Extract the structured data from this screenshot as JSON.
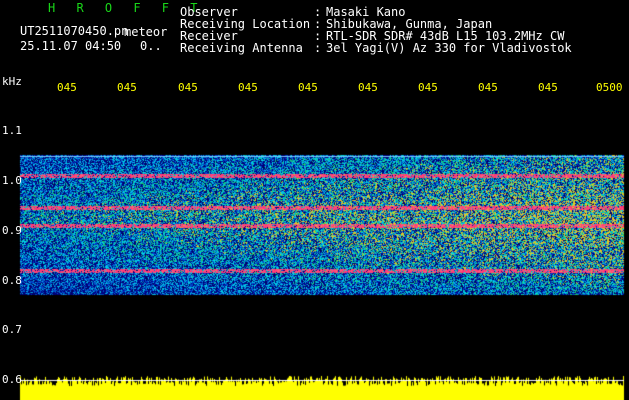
{
  "header": {
    "app_name": "H R O F F T",
    "filename": "UT2511070450.pn",
    "tag": "meteor",
    "datetime": "25.11.07 04:50",
    "count": "0..",
    "fields": [
      {
        "label": "Observer",
        "value": "Masaki Kano"
      },
      {
        "label": "Receiving Location",
        "value": "Shibukawa, Gunma, Japan"
      },
      {
        "label": "Receiver",
        "value": "RTL-SDR SDR# 43dB L15 103.2MHz CW"
      },
      {
        "label": "Receiving Antenna",
        "value": "3el Yagi(V) Az 330 for Vladivostok"
      }
    ]
  },
  "axis": {
    "y_unit": "kHz",
    "y_ticks": [
      "1.1",
      "1.0",
      "0.9",
      "0.8",
      "0.7",
      "0.6"
    ],
    "x_ticks": [
      "045",
      "045",
      "045",
      "045",
      "045",
      "045",
      "045",
      "045",
      "045",
      "0500"
    ]
  },
  "colors": {
    "background": "#000000",
    "header_green": "#19d619",
    "axis_yellow": "#ffff00",
    "noise_floor": "#ffff00",
    "signal_red": "#ff3060",
    "band_blue": "#1030c0"
  },
  "spectrogram": {
    "band_top_khz": 1.05,
    "band_bottom_khz": 0.77,
    "signal_lines_khz": [
      0.945,
      0.91,
      0.82,
      1.01
    ]
  }
}
